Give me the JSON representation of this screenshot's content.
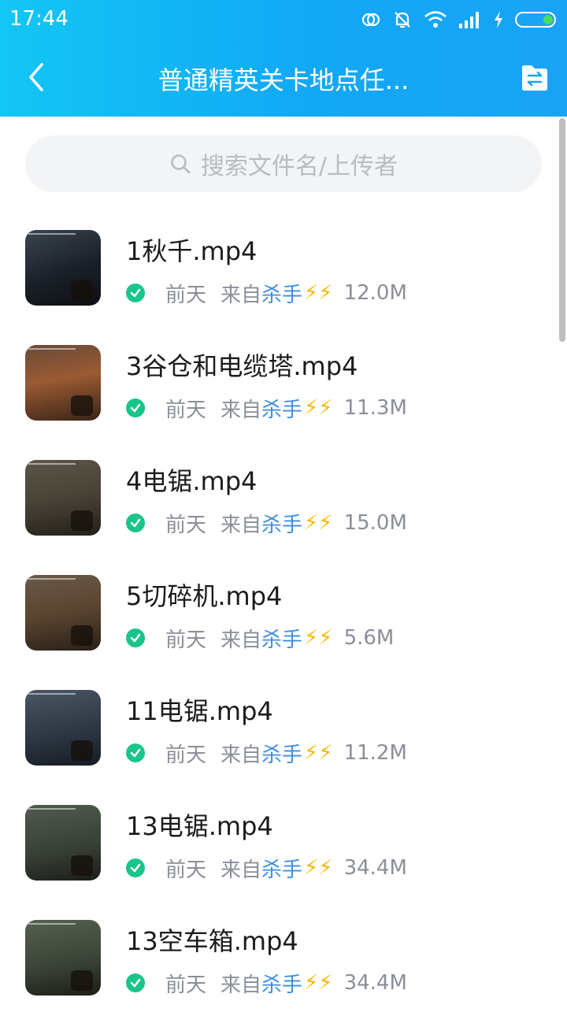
{
  "status_bar": {
    "time": "17:44"
  },
  "nav": {
    "title": "普通精英关卡地点任..."
  },
  "search": {
    "placeholder": "搜索文件名/上传者"
  },
  "colors": {
    "accent": "#12a8f6",
    "uploader": "#3f8ee0",
    "check": "#19c58a",
    "bolt": "#f5b800"
  },
  "files": [
    {
      "name": "1秋千.mp4",
      "when": "前天",
      "from": "来自",
      "uploader": "杀手",
      "bolts": "⚡⚡",
      "size": "12.0M"
    },
    {
      "name": "3谷仓和电缆塔.mp4",
      "when": "前天",
      "from": "来自",
      "uploader": "杀手",
      "bolts": "⚡⚡",
      "size": "11.3M"
    },
    {
      "name": "4电锯.mp4",
      "when": "前天",
      "from": "来自",
      "uploader": "杀手",
      "bolts": "⚡⚡",
      "size": "15.0M"
    },
    {
      "name": "5切碎机.mp4",
      "when": "前天",
      "from": "来自",
      "uploader": "杀手",
      "bolts": "⚡⚡",
      "size": "5.6M"
    },
    {
      "name": "11电锯.mp4",
      "when": "前天",
      "from": "来自",
      "uploader": "杀手",
      "bolts": "⚡⚡",
      "size": "11.2M"
    },
    {
      "name": "13电锯.mp4",
      "when": "前天",
      "from": "来自",
      "uploader": "杀手",
      "bolts": "⚡⚡",
      "size": "34.4M"
    },
    {
      "name": "13空车箱.mp4",
      "when": "前天",
      "from": "来自",
      "uploader": "杀手",
      "bolts": "⚡⚡",
      "size": "34.4M"
    }
  ]
}
